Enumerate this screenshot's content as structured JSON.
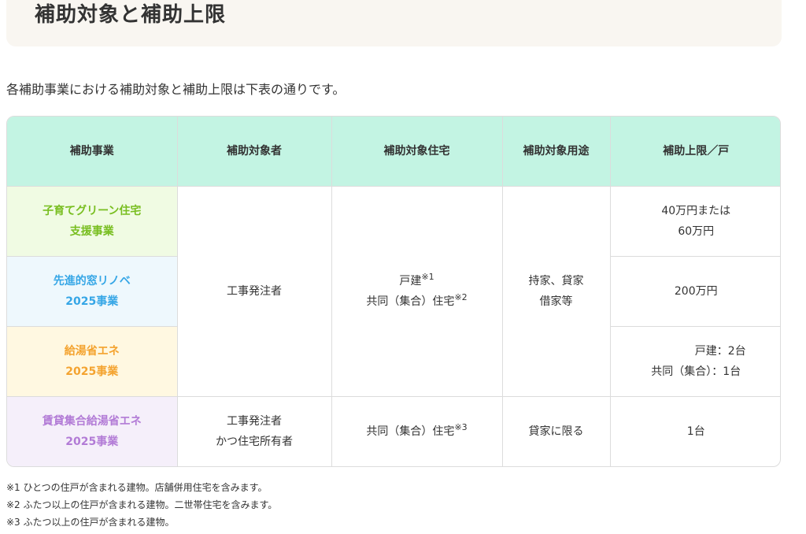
{
  "header": {
    "title": "補助対象と補助上限"
  },
  "intro": "各補助事業における補助対象と補助上限は下表の通りです。",
  "table": {
    "headers": [
      "補助事業",
      "補助対象者",
      "補助対象住宅",
      "補助対象用途",
      "補助上限／戸"
    ],
    "rows": [
      {
        "program_line1": "子育てグリーン住宅",
        "program_line2": "支援事業",
        "cap_line1": "40万円または",
        "cap_line2": "60万円"
      },
      {
        "program_line1": "先進的窓リノベ",
        "program_line2": "2025事業",
        "cap": "200万円"
      },
      {
        "program_line1": "給湯省エネ",
        "program_line2": "2025事業",
        "cap_line1": "戸建：2台",
        "cap_line2": "共同（集合）：1台"
      },
      {
        "program_line1": "賃貸集合給湯省エネ",
        "program_line2": "2025事業",
        "target_line1": "工事発注者",
        "target_line2": "かつ住宅所有者",
        "housing": "共同（集合）住宅",
        "housing_note": "※3",
        "use": "貸家に限る",
        "cap": "1台"
      }
    ],
    "merged": {
      "target": "工事発注者",
      "housing_line1": "戸建",
      "housing_note1": "※1",
      "housing_line2": "共同（集合）住宅",
      "housing_note2": "※2",
      "use_line1": "持家、貸家",
      "use_line2": "借家等"
    }
  },
  "notes": [
    "※1  ひとつの住戸が含まれる建物。店舗併用住宅を含みます。",
    "※2  ふたつ以上の住戸が含まれる建物。二世帯住宅を含みます。",
    "※3  ふたつ以上の住戸が含まれる建物。"
  ],
  "colors": {
    "header_bg": "#c3f4e3",
    "program1": "#78be20",
    "program2": "#35a6e6",
    "program3": "#f4a32f",
    "program4": "#b27bd6"
  }
}
